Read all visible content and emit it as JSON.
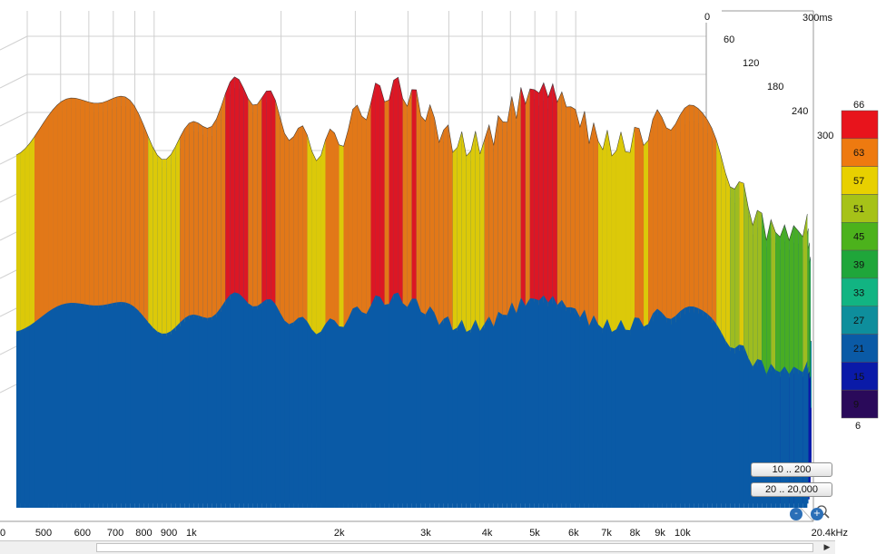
{
  "chart_data": {
    "type": "waterfall-3d",
    "x_tick_labels": [
      "500",
      "600",
      "700",
      "800",
      "900",
      "1k",
      "2k",
      "3k",
      "4k",
      "5k",
      "6k",
      "7k",
      "8k",
      "9k",
      "10k",
      "20.4kHz"
    ],
    "x_tick_values": [
      500,
      600,
      700,
      800,
      900,
      1000,
      2000,
      3000,
      4000,
      5000,
      6000,
      7000,
      8000,
      9000,
      10000,
      20400
    ],
    "x_left_label": "0",
    "time_labels": [
      "0",
      "60",
      "120",
      "180",
      "240",
      "300"
    ],
    "time_top_label": "300ms",
    "time_values_ms": [
      0,
      60,
      120,
      180,
      240,
      300
    ],
    "color_scale": {
      "labels": [
        "66",
        "63",
        "57",
        "51",
        "45",
        "39",
        "33",
        "27",
        "21",
        "15",
        "9",
        "6"
      ],
      "bands": [
        {
          "from": 63,
          "to": 66,
          "color": "#e8141c"
        },
        {
          "from": 57,
          "to": 63,
          "color": "#ee7a10"
        },
        {
          "from": 51,
          "to": 57,
          "color": "#e8d000"
        },
        {
          "from": 45,
          "to": 51,
          "color": "#a6c218"
        },
        {
          "from": 39,
          "to": 45,
          "color": "#4cb21c"
        },
        {
          "from": 33,
          "to": 39,
          "color": "#1fa63a"
        },
        {
          "from": 27,
          "to": 33,
          "color": "#12b482"
        },
        {
          "from": 21,
          "to": 27,
          "color": "#0e8e9c"
        },
        {
          "from": 15,
          "to": 21,
          "color": "#0a5aa6"
        },
        {
          "from": 9,
          "to": 15,
          "color": "#0a1aa8"
        },
        {
          "from": 6,
          "to": 9,
          "color": "#2a0a5a"
        }
      ]
    },
    "grid": true
  },
  "controls": {
    "range_y": "10 .. 200",
    "range_x": "20 .. 20,000",
    "zoom_out": "-",
    "zoom_in": "+"
  },
  "icons": {
    "zoom": "magnifier-icon",
    "scroll_right": "arrow-right-icon"
  }
}
